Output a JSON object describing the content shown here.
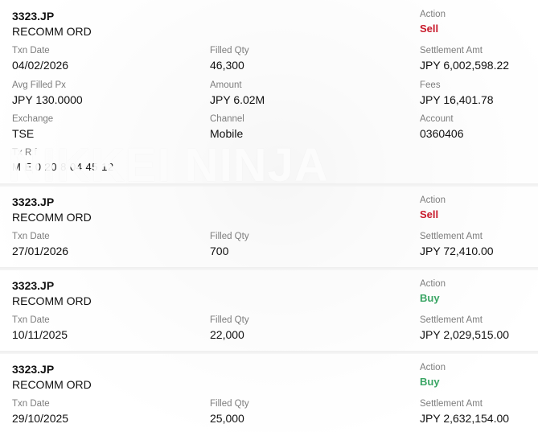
{
  "transactions": [
    {
      "symbol": "3323.JP",
      "order_type": "RECOMM ORD",
      "action_label": "Action",
      "action": "Sell",
      "txn_date_label": "Txn Date",
      "txn_date": "04/02/2026",
      "filled_qty_label": "Filled Qty",
      "filled_qty": "46,300",
      "settlement_label": "Settlement Amt",
      "settlement": "JPY 6,002,598.22",
      "avg_px_label": "Avg Filled Px",
      "avg_px": "JPY 130.0000",
      "amount_label": "Amount",
      "amount": "JPY 6.02M",
      "fees_label": "Fees",
      "fees": "JPY 16,401.78",
      "exchange_label": "Exchange",
      "exchange": "TSE",
      "channel_label": "Channel",
      "channel": "Mobile",
      "account_label": "Account",
      "account": "0360406",
      "ref_label": "Tx R f",
      "ref": "M E 0 20 8 04 45 12"
    },
    {
      "symbol": "3323.JP",
      "order_type": "RECOMM ORD",
      "action_label": "Action",
      "action": "Sell",
      "txn_date_label": "Txn Date",
      "txn_date": "27/01/2026",
      "filled_qty_label": "Filled Qty",
      "filled_qty": "700",
      "settlement_label": "Settlement Amt",
      "settlement": "JPY 72,410.00"
    },
    {
      "symbol": "3323.JP",
      "order_type": "RECOMM ORD",
      "action_label": "Action",
      "action": "Buy",
      "txn_date_label": "Txn Date",
      "txn_date": "10/11/2025",
      "filled_qty_label": "Filled Qty",
      "filled_qty": "22,000",
      "settlement_label": "Settlement Amt",
      "settlement": "JPY 2,029,515.00"
    },
    {
      "symbol": "3323.JP",
      "order_type": "RECOMM ORD",
      "action_label": "Action",
      "action": "Buy",
      "txn_date_label": "Txn Date",
      "txn_date": "29/10/2025",
      "filled_qty_label": "Filled Qty",
      "filled_qty": "25,000",
      "settlement_label": "Settlement Amt",
      "settlement": "JPY 2,632,154.00"
    }
  ],
  "watermark": "NIKKEI NINJA",
  "colors": {
    "sell": "#c8192b",
    "buy": "#3aa564",
    "label": "#7d7d7d"
  }
}
